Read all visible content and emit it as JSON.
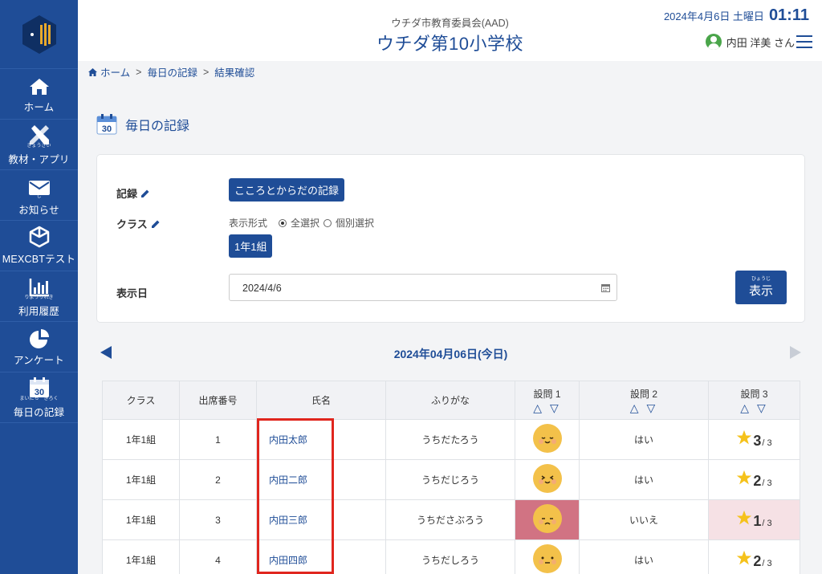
{
  "colors": {
    "brand": "#1f4d97",
    "highlight": "#e0261e",
    "answer_no": "#d17383",
    "answer_low": "#f6e1e5",
    "star": "#f5c21b",
    "face": "#f3c14a"
  },
  "sidebar": {
    "items": [
      {
        "icon": "home-icon",
        "label": "ホーム",
        "ruby": ""
      },
      {
        "icon": "pencil-ruler-icon",
        "label": "教材・アプリ",
        "ruby": "きょうざい"
      },
      {
        "icon": "envelope-icon",
        "label": "お知らせ",
        "ruby": "し"
      },
      {
        "icon": "cube-icon",
        "label": "MEXCBTテスト",
        "ruby": ""
      },
      {
        "icon": "bar-chart-icon",
        "label": "利用履歴",
        "ruby": "りようりれき"
      },
      {
        "icon": "pie-chart-icon",
        "label": "アンケート",
        "ruby": ""
      },
      {
        "icon": "calendar-icon",
        "label": "毎日の記録",
        "ruby": "まいにち　きろく",
        "badge": "30"
      }
    ]
  },
  "header": {
    "org": "ウチダ市教育委員会(AAD)",
    "school": "ウチダ第10小学校",
    "date": "2024年4月6日 土曜日",
    "time": "01:11",
    "user": "内田 洋美 さん"
  },
  "breadcrumb": {
    "home": "ホーム",
    "sep": ">",
    "daily": "毎日の記録",
    "result": "結果確認"
  },
  "page": {
    "title": "毎日の記録",
    "badge": "30"
  },
  "form": {
    "record_label": "記録",
    "record_value": "こころとからだの記録",
    "class_label": "クラス",
    "format_label": "表示形式",
    "opt_all": "全選択",
    "opt_individual": "個別選択",
    "class_value": "1年1組",
    "date_label": "表示日",
    "date_value": "2024/4/6",
    "show_button": "表示",
    "show_ruby": "ひょうじ"
  },
  "results": {
    "heading": "2024年04月06日(今日)",
    "headers": {
      "class": "クラス",
      "number": "出席番号",
      "name": "氏名",
      "furigana": "ふりがな",
      "q1": "設問 1",
      "q2": "設問 2",
      "q3": "設問 3",
      "sort": "△ ▽"
    },
    "rows": [
      {
        "class": "1年1組",
        "number": "1",
        "name": "内田太郎",
        "furigana": "うちだたろう",
        "q1_face": "happy",
        "q2": "はい",
        "q3": "3",
        "q3_den": "/ 3"
      },
      {
        "class": "1年1組",
        "number": "2",
        "name": "内田二郎",
        "furigana": "うちだじろう",
        "q1_face": "squint",
        "q2": "はい",
        "q3": "2",
        "q3_den": "/ 3"
      },
      {
        "class": "1年1組",
        "number": "3",
        "name": "内田三郎",
        "furigana": "うちださぶろう",
        "q1_face": "sad",
        "q2": "いいえ",
        "q3": "1",
        "q3_den": "/ 3"
      },
      {
        "class": "1年1組",
        "number": "4",
        "name": "内田四郎",
        "furigana": "うちだしろう",
        "q1_face": "neutral",
        "q2": "はい",
        "q3": "2",
        "q3_den": "/ 3"
      }
    ]
  }
}
